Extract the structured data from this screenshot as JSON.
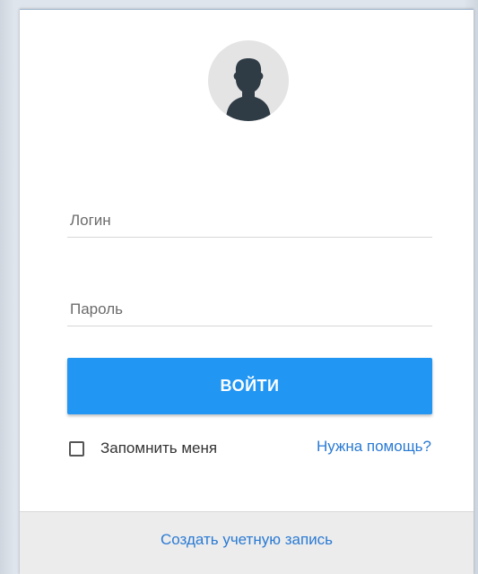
{
  "avatar": {
    "icon": "user-silhouette-icon"
  },
  "login": {
    "placeholder": "Логин",
    "value": ""
  },
  "password": {
    "placeholder": "Пароль",
    "value": ""
  },
  "submit": {
    "label": "ВОЙТИ"
  },
  "remember": {
    "label": "Запомнить меня",
    "checked": false
  },
  "help": {
    "label": "Нужна помощь?"
  },
  "footer": {
    "create_account": "Создать учетную запись"
  },
  "colors": {
    "accent": "#2196f3",
    "link": "#2a7ad3",
    "footer_bg": "#ececec"
  }
}
